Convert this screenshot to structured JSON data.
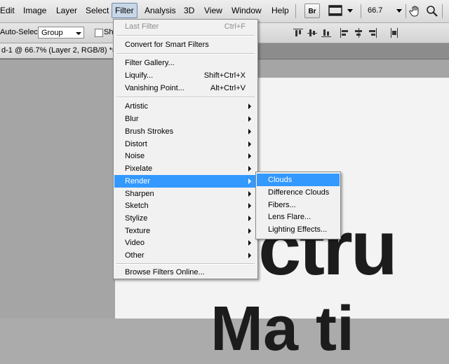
{
  "menubar": {
    "items": [
      {
        "label": "Edit"
      },
      {
        "label": "Image"
      },
      {
        "label": "Layer"
      },
      {
        "label": "Select"
      },
      {
        "label": "Filter"
      },
      {
        "label": "Analysis"
      },
      {
        "label": "3D"
      },
      {
        "label": "View"
      },
      {
        "label": "Window"
      },
      {
        "label": "Help"
      }
    ],
    "bridge_label": "Br",
    "zoom_value": "66.7"
  },
  "options": {
    "auto_select_label": "Auto-Select:",
    "auto_select_value": "Group",
    "show_transform_label": "Sh"
  },
  "document": {
    "tab_title": "d-1 @ 66.7% (Layer 2, RGB/8) *",
    "close_glyph": "×"
  },
  "canvas": {
    "text_line1": "ectru",
    "text_line2": "Ma ti"
  },
  "filter_menu": {
    "last_filter": {
      "label": "Last Filter",
      "shortcut": "Ctrl+F"
    },
    "convert": {
      "label": "Convert for Smart Filters"
    },
    "gallery": {
      "label": "Filter Gallery..."
    },
    "liquify": {
      "label": "Liquify...",
      "shortcut": "Shift+Ctrl+X"
    },
    "vanishing": {
      "label": "Vanishing Point...",
      "shortcut": "Alt+Ctrl+V"
    },
    "categories": [
      {
        "label": "Artistic"
      },
      {
        "label": "Blur"
      },
      {
        "label": "Brush Strokes"
      },
      {
        "label": "Distort"
      },
      {
        "label": "Noise"
      },
      {
        "label": "Pixelate"
      },
      {
        "label": "Render"
      },
      {
        "label": "Sharpen"
      },
      {
        "label": "Sketch"
      },
      {
        "label": "Stylize"
      },
      {
        "label": "Texture"
      },
      {
        "label": "Video"
      },
      {
        "label": "Other"
      }
    ],
    "browse": {
      "label": "Browse Filters Online..."
    }
  },
  "render_submenu": {
    "items": [
      {
        "label": "Clouds"
      },
      {
        "label": "Difference Clouds"
      },
      {
        "label": "Fibers..."
      },
      {
        "label": "Lens Flare..."
      },
      {
        "label": "Lighting Effects..."
      }
    ]
  },
  "colors": {
    "highlight": "#3399ff",
    "menu_bg": "#f1f1f1",
    "workspace": "#a5a5a5"
  }
}
